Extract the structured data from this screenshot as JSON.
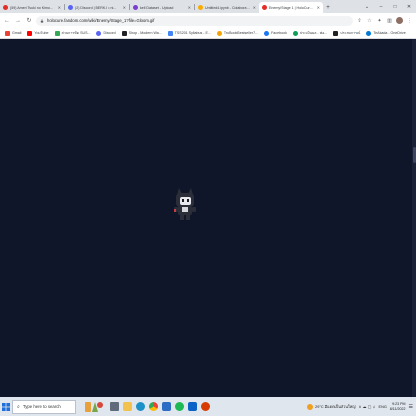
{
  "browser": {
    "tabs": [
      {
        "label": "(59) Ameri Tsuki no Kimo...",
        "favicon_color": "#e52d27",
        "active": false
      },
      {
        "label": "(2) Discord | BERK.I • ni...",
        "favicon_color": "#5865f2",
        "active": false
      },
      {
        "label": "kell Dataset - Upload",
        "favicon_color": "#7b3fd0",
        "active": false
      },
      {
        "label": "Untitled4.ipynb - Colaboratory",
        "favicon_color": "#f9ab00",
        "active": false
      },
      {
        "label": "Enemy/Stage 1 | HoloCure Wiki",
        "favicon_color": "#e52d27",
        "active": true
      }
    ],
    "new_tab": "+",
    "window_controls": {
      "chevron": "⌄",
      "minimize": "–",
      "maximize": "□",
      "close": "✕"
    },
    "nav": {
      "back": "←",
      "forward": "→",
      "reload": "↻"
    },
    "url": "holocure.fandom.com/wiki/Enemy/Stage_1?file=Gloom.gif",
    "toolbar_icons": {
      "share": "⇧",
      "star": "☆",
      "extensions": "✦",
      "sidepanel": "▥",
      "menu": "⋮"
    }
  },
  "bookmarks": [
    {
      "label": "Gmail",
      "icon_color": "#ea4335"
    },
    {
      "label": "YouTube",
      "icon_color": "#ff0000"
    },
    {
      "label": "ส่วนการขัด SUS...",
      "icon_color": "#34a853"
    },
    {
      "label": "Discord",
      "icon_color": "#5865f2"
    },
    {
      "label": "Shop - Modern Wa...",
      "icon_color": "#202124"
    },
    {
      "label": "TSS201 Syllabus - E...",
      "icon_color": "#4285f4"
    },
    {
      "label": "TruBookBestseller7...",
      "icon_color": "#f4a300"
    },
    {
      "label": "Facebook",
      "icon_color": "#1877f2"
    },
    {
      "label": "ประเมินผล - ฟอ...",
      "icon_color": "#0f9d58"
    },
    {
      "label": "ประสบการณ์",
      "icon_color": "#202124"
    },
    {
      "label": "TeAkada - OneDrive",
      "icon_color": "#0078d4"
    }
  ],
  "content": {
    "background": "#0f1629"
  },
  "taskbar": {
    "search_placeholder": "Type here to search",
    "task_icons": [
      {
        "name": "task-view",
        "color": "#5f6b7a"
      },
      {
        "name": "file-explorer",
        "color": "#f2c14e"
      },
      {
        "name": "edge",
        "color": "#1e90c8"
      },
      {
        "name": "chrome",
        "color": "#34a853"
      },
      {
        "name": "store",
        "color": "#2b6cc4"
      },
      {
        "name": "spotify",
        "color": "#1db954"
      },
      {
        "name": "mail",
        "color": "#0a64c8"
      },
      {
        "name": "photos",
        "color": "#d83b01"
      }
    ],
    "weather": "29°C มีแดดเป็นส่วนใหญ่",
    "tray_icons": "∧  ☁  ▢  ♫",
    "language": "ENG",
    "time": "9:23 PM",
    "date": "8/11/2022",
    "notification": "☰"
  }
}
